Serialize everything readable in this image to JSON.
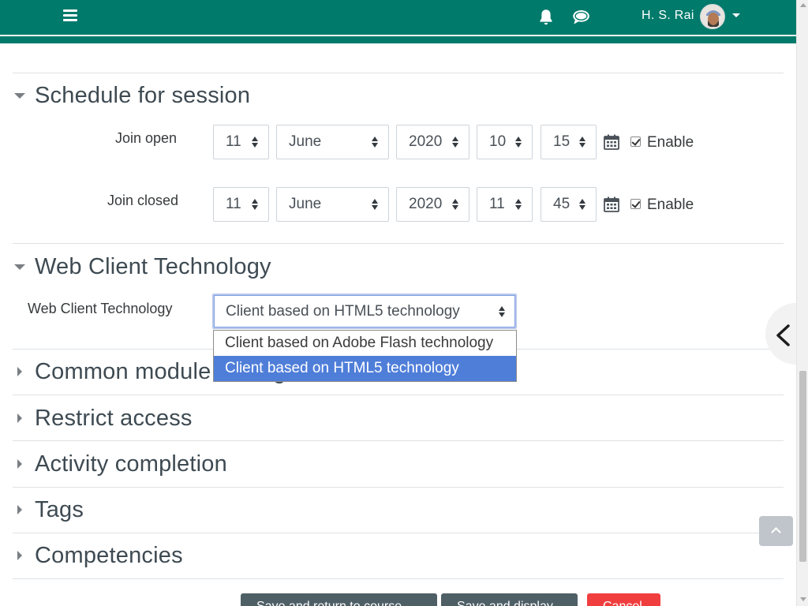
{
  "navbar": {
    "menu_icon": "hamburger-icon",
    "notifications_icon": "bell-icon",
    "messages_icon": "chat-icon",
    "user_name": "H. S. Rai",
    "accent": "#007a6b"
  },
  "sections": {
    "schedule": {
      "title": "Schedule for session",
      "join_open": {
        "label": "Join open",
        "day": "11",
        "month": "June",
        "year": "2020",
        "hour": "10",
        "minute": "15",
        "enable_label": "Enable",
        "enabled": true
      },
      "join_closed": {
        "label": "Join closed",
        "day": "11",
        "month": "June",
        "year": "2020",
        "hour": "11",
        "minute": "45",
        "enable_label": "Enable",
        "enabled": true
      }
    },
    "web_client": {
      "title": "Web Client Technology",
      "field_label": "Web Client Technology",
      "selected": "Client based on HTML5 technology",
      "options": [
        "Client based on Adobe Flash technology",
        "Client based on HTML5 technology"
      ],
      "highlight_color": "#4f7ed9"
    },
    "collapsed": [
      {
        "title": "Common module settings"
      },
      {
        "title": "Restrict access"
      },
      {
        "title": "Activity completion"
      },
      {
        "title": "Tags"
      },
      {
        "title": "Competencies"
      }
    ]
  },
  "buttons": {
    "save_return": "Save and return to course",
    "save_display": "Save and display",
    "cancel": "Cancel"
  }
}
